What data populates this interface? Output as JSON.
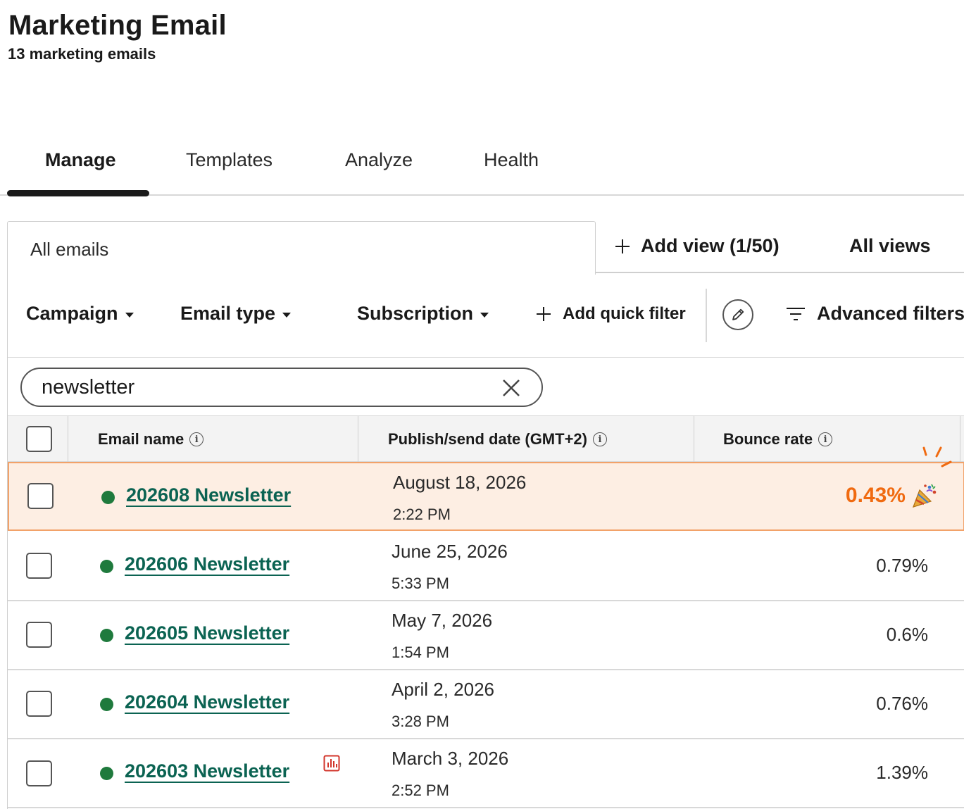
{
  "header": {
    "title": "Marketing Email",
    "subtitle": "13 marketing emails"
  },
  "tabs": [
    {
      "label": "Manage",
      "active": true
    },
    {
      "label": "Templates",
      "active": false
    },
    {
      "label": "Analyze",
      "active": false
    },
    {
      "label": "Health",
      "active": false
    }
  ],
  "views": {
    "current": "All emails",
    "add_view_label": "Add view (1/50)",
    "all_views_label": "All views"
  },
  "filters": {
    "campaign": "Campaign",
    "email_type": "Email type",
    "subscription": "Subscription",
    "add_quick_filter": "Add quick filter",
    "advanced_filters": "Advanced filters"
  },
  "search": {
    "value": "newsletter"
  },
  "table": {
    "columns": {
      "name": "Email name",
      "date": "Publish/send date (GMT+2)",
      "bounce": "Bounce rate"
    },
    "rows": [
      {
        "name": "202608 Newsletter",
        "date": "August 18, 2026",
        "time": "2:22 PM",
        "bounce_rate": "0.43%",
        "highlighted": true
      },
      {
        "name": "202606 Newsletter",
        "date": "June 25, 2026",
        "time": "5:33 PM",
        "bounce_rate": "0.79%",
        "highlighted": false
      },
      {
        "name": "202605 Newsletter",
        "date": "May 7, 2026",
        "time": "1:54 PM",
        "bounce_rate": "0.6%",
        "highlighted": false
      },
      {
        "name": "202604 Newsletter",
        "date": "April 2, 2026",
        "time": "3:28 PM",
        "bounce_rate": "0.76%",
        "highlighted": false
      },
      {
        "name": "202603 Newsletter",
        "date": "March 3, 2026",
        "time": "2:52 PM",
        "bounce_rate": "1.39%",
        "highlighted": false
      }
    ]
  },
  "colors": {
    "link": "#0b6352",
    "status_published": "#1f7a3d",
    "highlight_bg": "#fdeee3",
    "highlight_border": "#f2a269",
    "highlight_text": "#f06a10"
  },
  "icons": {
    "celebration": "party-popper-icon",
    "report": "bar-chart-report-icon"
  }
}
